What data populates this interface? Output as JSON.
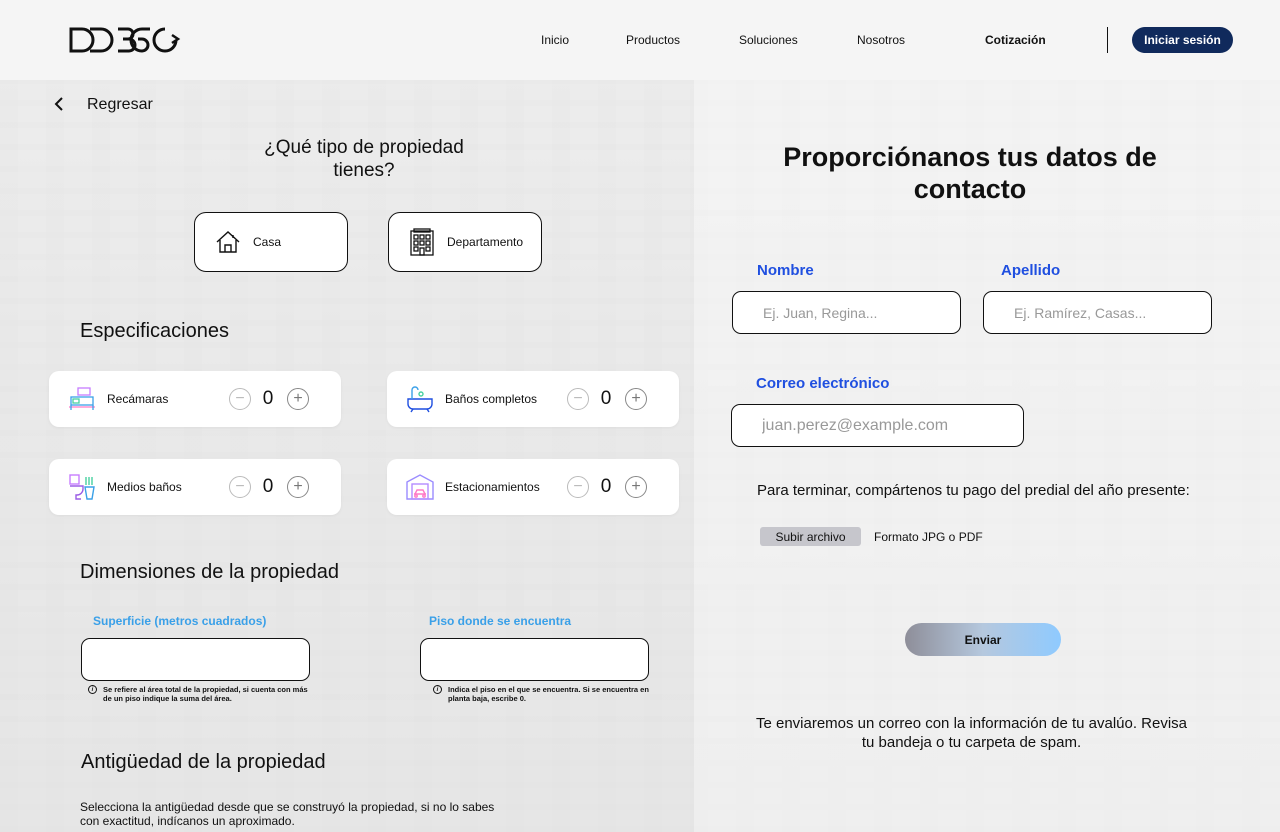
{
  "header": {
    "logo_text": "DD360",
    "nav": [
      "Inicio",
      "Productos",
      "Soluciones",
      "Nosotros",
      "Cotización"
    ],
    "login_label": "Iniciar sesión"
  },
  "left": {
    "back_label": "Regresar",
    "property_question": "¿Qué tipo de propiedad tienes?",
    "property_types": [
      {
        "label": "Casa",
        "icon": "house-icon"
      },
      {
        "label": "Departamento",
        "icon": "building-icon"
      }
    ],
    "specs_title": "Especificaciones",
    "specs": [
      {
        "label": "Recámaras",
        "count": "0",
        "icon": "bed-icon"
      },
      {
        "label": "Baños completos",
        "count": "0",
        "icon": "bathtub-icon"
      },
      {
        "label": "Medios baños",
        "count": "0",
        "icon": "toilet-icon"
      },
      {
        "label": "Estacionamientos",
        "count": "0",
        "icon": "garage-icon"
      }
    ],
    "dimensions_title": "Dimensiones de la propiedad",
    "surface_label": "Superficie (metros cuadrados)",
    "surface_hint": "Se refiere al área total de la propiedad, si cuenta con más de un piso indique la suma del área.",
    "floor_label": "Piso donde se encuentra",
    "floor_hint": "Indica el piso en el que se encuentra. Si se encuentra en planta baja, escribe 0.",
    "age_title": "Antigüedad de la propiedad",
    "age_description": "Selecciona la antigüedad desde que se construyó la propiedad, si no lo sabes con exactitud, indícanos un aproximado."
  },
  "right": {
    "title": "Proporciónanos tus datos de contacto",
    "first_name_label": "Nombre",
    "first_name_placeholder": "Ej. Juan, Regina...",
    "last_name_label": "Apellido",
    "last_name_placeholder": "Ej. Ramírez, Casas...",
    "email_label": "Correo electrónico",
    "email_placeholder": "juan.perez@example.com",
    "predial_text": "Para terminar, compártenos tu pago del predial del año presente:",
    "upload_label": "Subir archivo",
    "format_text": "Formato JPG o PDF",
    "send_label": "Enviar",
    "notice": "Te enviaremos un correo con la información de tu avalúo. Revisa tu bandeja o tu carpeta de spam."
  },
  "colors": {
    "primary_navy": "#102a5c",
    "label_blue": "#1f4fe0",
    "label_light_blue": "#3aa0e8"
  }
}
